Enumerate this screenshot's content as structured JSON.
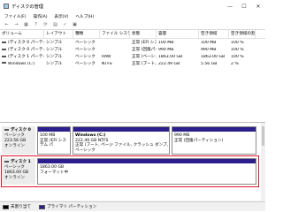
{
  "window": {
    "title": "ディスクの管理",
    "controls": [
      "—",
      "☐",
      "✕"
    ]
  },
  "menu": [
    "ファイル(F)",
    "操作(A)",
    "表示(V)",
    "ヘルプ(H)"
  ],
  "toolbar": [
    "back-icon",
    "forward-icon",
    "grid-icon",
    "help-icon",
    "refresh-icon",
    "properties-icon",
    "check-icon",
    "view-icon"
  ],
  "volumes": {
    "headers": [
      "ボリューム",
      "レイアウト",
      "種類",
      "ファイル システム",
      "状態",
      "容量",
      "空き領域",
      "空き領域の割..."
    ],
    "rows": [
      [
        "(ディスク 0 パーティション 1)",
        "シンプル",
        "ベーシック",
        "",
        "正常 (EFI システ...",
        "100 MB",
        "100 MB",
        "100 %"
      ],
      [
        "(ディスク 0 パーティション 2)",
        "シンプル",
        "ベーシック",
        "",
        "正常 (回復パーティ...",
        "990 MB",
        "990 MB",
        "100 %"
      ],
      [
        "(ディスク 1 パーティション 1)",
        "シンプル",
        "ベーシック",
        "RAW",
        "正常 (ベーシック...",
        "1863.00 GB",
        "1863.00 GB",
        "100 %"
      ],
      [
        "Windows (C:)",
        "シンプル",
        "ベーシック",
        "NTFS",
        "正常 (ブート、ペ...",
        "222.49 GB",
        "5.56 GB",
        "2 %"
      ]
    ]
  },
  "disks": [
    {
      "name": "ディスク 0",
      "type": "ベーシック",
      "size": "223.56 GB",
      "status": "オンライン",
      "partitions": [
        {
          "name": "",
          "size": "100 MB",
          "desc": "正常 (EFI システム パ"
        },
        {
          "name": "Windows (C:)",
          "size": "222.49 GB NTFS",
          "desc": "正常 (ブート, ページ ファイル, クラッシュ ダンプ, ベーシック"
        },
        {
          "name": "",
          "size": "990 MB",
          "desc": "正常 (回復パーティション)"
        }
      ]
    },
    {
      "name": "ディスク 1",
      "type": "ベーシック",
      "size": "1863.00 GB",
      "status": "オンライン",
      "partitions": [
        {
          "name": "",
          "size": "1863.00 GB",
          "desc": "フォーマット中"
        }
      ]
    }
  ],
  "legend": [
    {
      "label": "未割り当て",
      "color": "#000000"
    },
    {
      "label": "プライマリ パーティション",
      "color": "#2a1f8c"
    }
  ],
  "colors": {
    "partition_stripe": "#2a1f8c",
    "selected_outline": "#e0182d"
  }
}
